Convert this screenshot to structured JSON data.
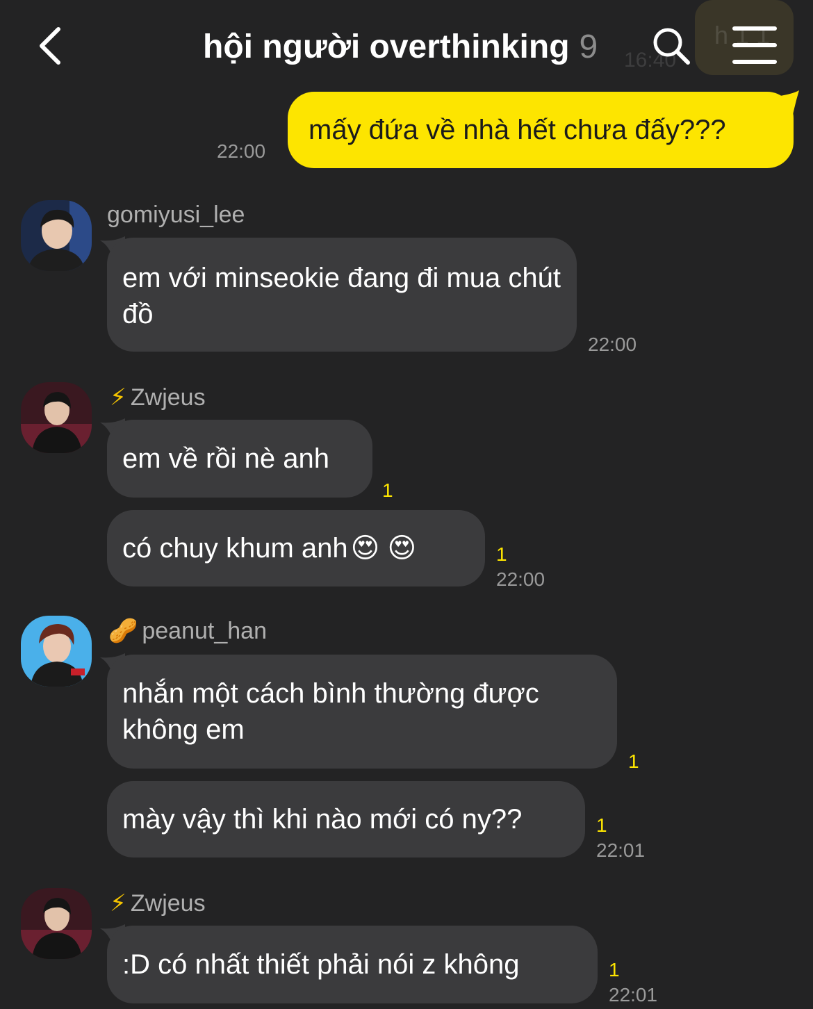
{
  "header": {
    "title": "hội người overthinking",
    "member_count": "9",
    "ghost_time": "16:40",
    "ghost_label": "h 1 1"
  },
  "messages": [
    {
      "sender": "",
      "mine": true,
      "text": "mấy đứa về nhà hết chưa đấy???",
      "time": "22:00",
      "unread": ""
    },
    {
      "sender": "gomiyusi_lee",
      "sender_emoji": "",
      "text": "em với minseokie đang đi mua chút đồ",
      "time": "22:00",
      "unread": ""
    },
    {
      "sender": "Zwjeus",
      "sender_emoji": "⚡",
      "text": "em về rồi nè anh",
      "time": "",
      "unread": "1"
    },
    {
      "sender": "Zwjeus",
      "sender_emoji": "⚡",
      "text": "có chuy khum anh",
      "emoji_suffix": "😍 😍",
      "time": "22:00",
      "unread": "1"
    },
    {
      "sender": "peanut_han",
      "sender_emoji": "🥜",
      "text": "nhắn một cách bình thường được không em",
      "time": "",
      "unread": "1"
    },
    {
      "sender": "peanut_han",
      "sender_emoji": "🥜",
      "text": "mày vậy thì khi nào mới có ny??",
      "time": "22:01",
      "unread": "1"
    },
    {
      "sender": "Zwjeus",
      "sender_emoji": "⚡",
      "text": ":D có nhất thiết phải nói z không",
      "time": "22:01",
      "unread": "1"
    }
  ],
  "colors": {
    "background": "#232324",
    "my_bubble": "#fde500",
    "other_bubble": "#3b3b3d",
    "unread": "#fde500"
  },
  "icons": {
    "back": "chevron-left-icon",
    "search": "search-icon",
    "menu": "hamburger-menu-icon"
  }
}
